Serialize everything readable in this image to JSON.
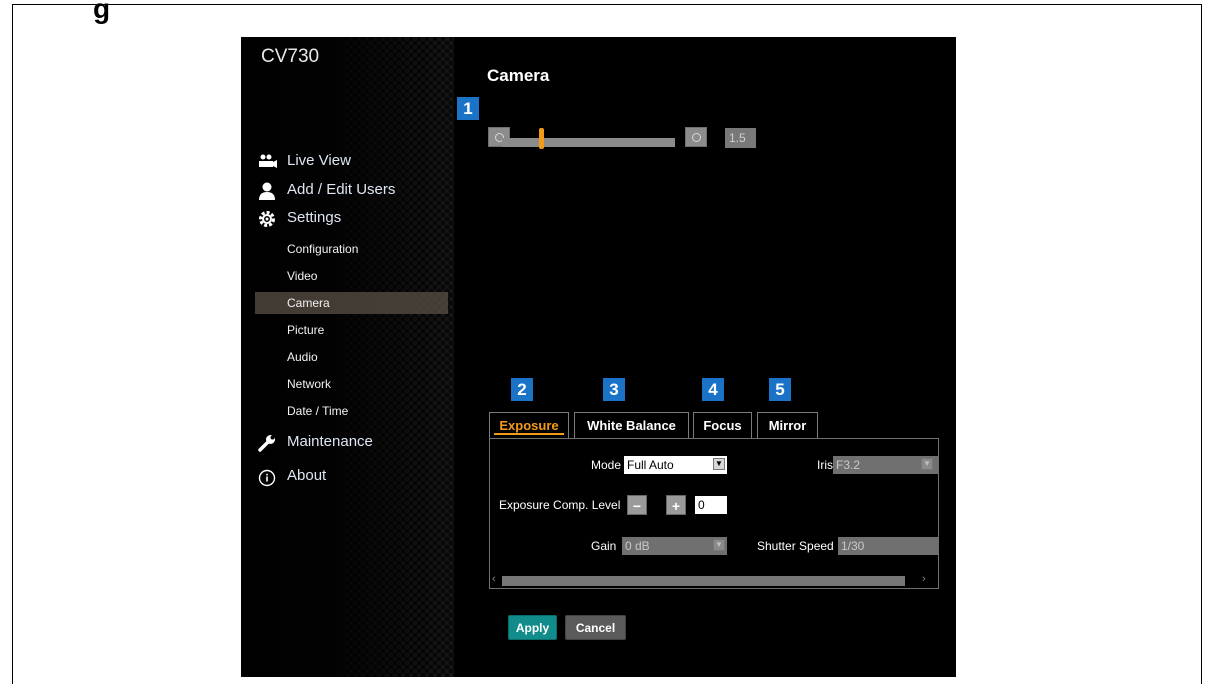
{
  "doc_heading_fragment": "g",
  "app": {
    "device_name": "CV730",
    "nav": {
      "live_view": "Live View",
      "add_edit_users": "Add / Edit Users",
      "settings": "Settings",
      "maintenance": "Maintenance",
      "about": "About"
    },
    "settings_sub": [
      "Configuration",
      "Video",
      "Camera",
      "Picture",
      "Audio",
      "Network",
      "Date / Time"
    ],
    "active_sub": "Camera"
  },
  "main": {
    "title": "Camera",
    "badges": [
      "1",
      "2",
      "3",
      "4",
      "5"
    ],
    "zoom": {
      "value_text": "1.5",
      "slider_fraction": 0.21
    },
    "tabs": [
      "Exposure",
      "White Balance",
      "Focus",
      "Mirror"
    ],
    "active_tab": "Exposure",
    "exposure": {
      "mode_label": "Mode",
      "mode_value": "Full Auto",
      "iris_label": "Iris",
      "iris_value": "F3.2",
      "comp_label": "Exposure Comp. Level",
      "comp_minus": "−",
      "comp_plus": "+",
      "comp_value": "0",
      "gain_label": "Gain",
      "gain_value": "0 dB",
      "shutter_label": "Shutter Speed",
      "shutter_value": "1/30"
    },
    "buttons": {
      "apply": "Apply",
      "cancel": "Cancel"
    }
  },
  "colors": {
    "accent_orange": "#f39a1a",
    "badge_blue": "#1a73c6",
    "apply_teal": "#128b8b"
  },
  "icons": [
    "camera-group-icon",
    "user-icon",
    "gear-icon",
    "wrench-icon",
    "info-icon"
  ]
}
